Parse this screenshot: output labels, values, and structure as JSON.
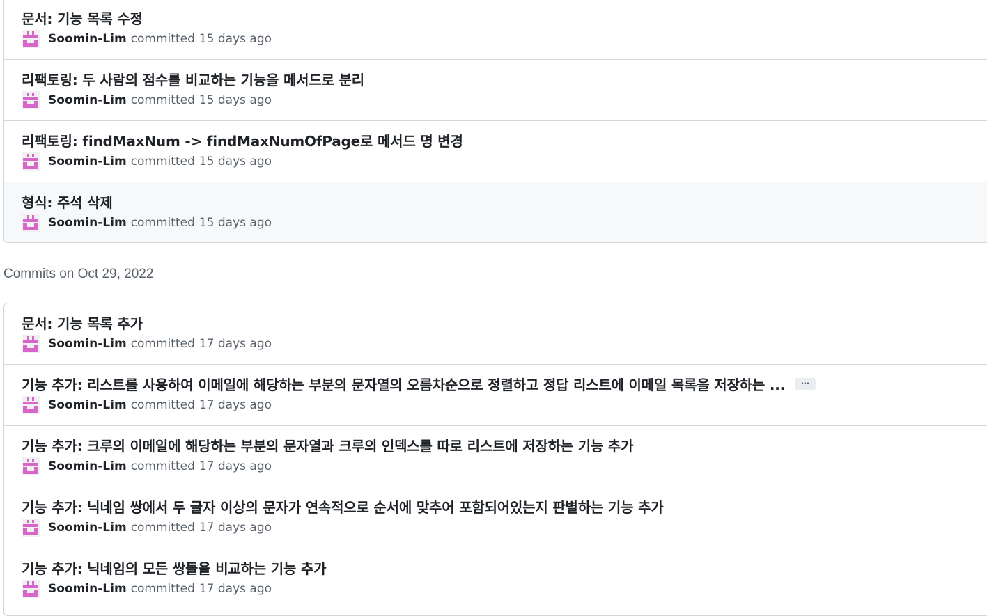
{
  "colors": {
    "avatar": "#d667c8",
    "border": "#d0d7de",
    "muted_text": "#57606a",
    "hover_bg": "#f6f8fa"
  },
  "icons": {
    "avatar": "identicon-avatar"
  },
  "group_1": {
    "commits": [
      {
        "title": "문서: 기능 목록 수정",
        "author": "Soomin-Lim",
        "verb": "committed",
        "ago": "15 days ago"
      },
      {
        "title": "리팩토링: 두 사람의 점수를 비교하는 기능을 메서드로 분리",
        "author": "Soomin-Lim",
        "verb": "committed",
        "ago": "15 days ago"
      },
      {
        "title": "리팩토링: findMaxNum -> findMaxNumOfPage로 메서드 명 변경",
        "author": "Soomin-Lim",
        "verb": "committed",
        "ago": "15 days ago"
      },
      {
        "title": "형식: 주석 삭제",
        "author": "Soomin-Lim",
        "verb": "committed",
        "ago": "15 days ago"
      }
    ]
  },
  "group_2": {
    "heading": "Commits on Oct 29, 2022",
    "commits": [
      {
        "title": "문서: 기능 목록 추가",
        "author": "Soomin-Lim",
        "verb": "committed",
        "ago": "17 days ago"
      },
      {
        "title": "기능 추가: 리스트를 사용하여 이메일에 해당하는 부분의 문자열의 오름차순으로 정렬하고 정답 리스트에 이메일 목록을 저장하는 ...",
        "ellipsis": "…",
        "author": "Soomin-Lim",
        "verb": "committed",
        "ago": "17 days ago"
      },
      {
        "title": "기능 추가: 크루의 이메일에 해당하는 부분의 문자열과 크루의 인덱스를 따로 리스트에 저장하는 기능 추가",
        "author": "Soomin-Lim",
        "verb": "committed",
        "ago": "17 days ago"
      },
      {
        "title": "기능 추가: 닉네임 쌍에서 두 글자 이상의 문자가 연속적으로 순서에 맞추어 포함되어있는지 판별하는 기능 추가",
        "author": "Soomin-Lim",
        "verb": "committed",
        "ago": "17 days ago"
      },
      {
        "title": "기능 추가: 닉네임의 모든 쌍들을 비교하는 기능 추가",
        "author": "Soomin-Lim",
        "verb": "committed",
        "ago": "17 days ago"
      }
    ]
  }
}
